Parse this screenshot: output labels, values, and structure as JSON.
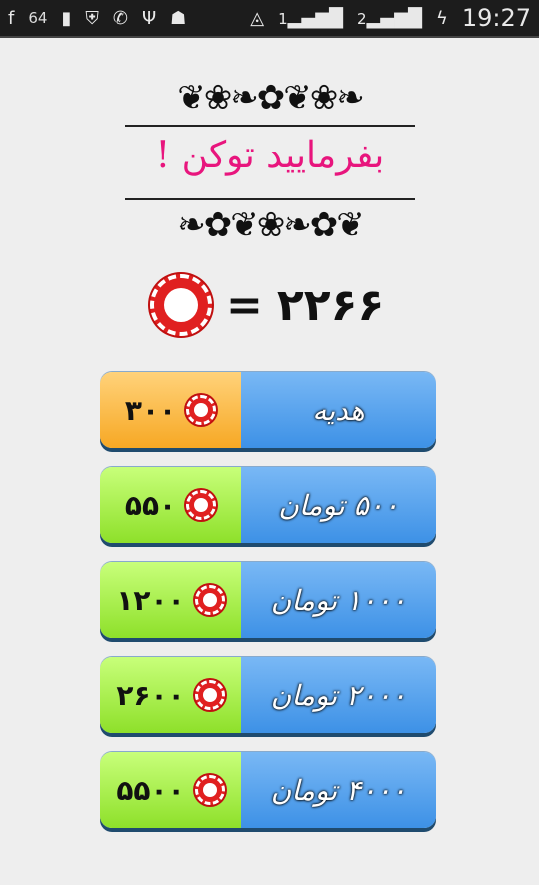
{
  "status_bar": {
    "notification_count": "64",
    "time": "19:27",
    "sim1": "1",
    "sim2": "2",
    "icons": [
      "facebook-icon",
      "usb-icon",
      "shield-icon",
      "viber-icon",
      "usb-debug-icon",
      "android-icon",
      "wifi-icon",
      "signal-sim1-icon",
      "signal-sim2-icon",
      "battery-charging-icon"
    ]
  },
  "header": {
    "title": "بفرمایید توکن !"
  },
  "balance": {
    "equals": "=",
    "amount": "۲۲۶۶"
  },
  "packages": [
    {
      "label": "هدیه",
      "tokens": "۳۰۰",
      "color": "#f7a824"
    },
    {
      "label": "۵۰۰ تومان",
      "tokens": "۵۵۰",
      "color": "#8ee02a"
    },
    {
      "label": "۱۰۰۰ تومان",
      "tokens": "۱۲۰۰",
      "color": "#8ee02a"
    },
    {
      "label": "۲۰۰۰ تومان",
      "tokens": "۲۶۰۰",
      "color": "#8ee02a"
    },
    {
      "label": "۴۰۰۰ تومان",
      "tokens": "۵۵۰۰",
      "color": "#8ee02a"
    }
  ]
}
